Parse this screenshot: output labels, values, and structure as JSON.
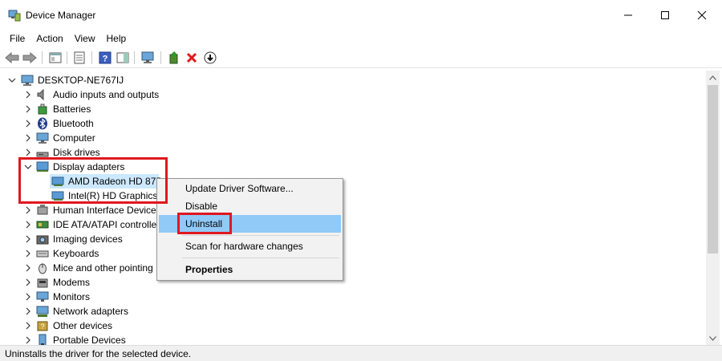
{
  "window": {
    "title": "Device Manager",
    "accent_border": "#4a90d9"
  },
  "menu": {
    "items": [
      "File",
      "Action",
      "View",
      "Help"
    ]
  },
  "toolbar": {
    "buttons": [
      "back-arrow-icon",
      "forward-arrow-icon",
      "show-hide-tree-icon",
      "properties-icon",
      "help-icon",
      "action-pane-icon",
      "scan-hardware-icon",
      "update-driver-icon",
      "uninstall-x-icon",
      "disable-down-arrow-icon"
    ],
    "uninstall_color": "#e0181e"
  },
  "tree": {
    "root": "DESKTOP-NE767IJ",
    "categories": [
      {
        "label": "Audio inputs and outputs",
        "icon": "speaker-icon"
      },
      {
        "label": "Batteries",
        "icon": "battery-icon"
      },
      {
        "label": "Bluetooth",
        "icon": "bluetooth-icon"
      },
      {
        "label": "Computer",
        "icon": "computer-icon"
      },
      {
        "label": "Disk drives",
        "icon": "disk-drive-icon"
      },
      {
        "label": "Display adapters",
        "icon": "display-adapter-icon",
        "expanded": true,
        "children": [
          "AMD Radeon HD 875",
          "Intel(R) HD Graphics"
        ]
      },
      {
        "label": "Human Interface Devices",
        "icon": "hid-icon"
      },
      {
        "label": "IDE ATA/ATAPI controller",
        "icon": "ide-controller-icon"
      },
      {
        "label": "Imaging devices",
        "icon": "camera-icon"
      },
      {
        "label": "Keyboards",
        "icon": "keyboard-icon"
      },
      {
        "label": "Mice and other pointing",
        "icon": "mouse-icon"
      },
      {
        "label": "Modems",
        "icon": "modem-icon"
      },
      {
        "label": "Monitors",
        "icon": "monitor-icon"
      },
      {
        "label": "Network adapters",
        "icon": "network-adapter-icon"
      },
      {
        "label": "Other devices",
        "icon": "other-devices-icon"
      },
      {
        "label": "Portable Devices",
        "icon": "portable-device-icon"
      }
    ]
  },
  "context_menu": {
    "items": [
      "Update Driver Software...",
      "Disable",
      "Uninstall",
      "Scan for hardware changes",
      "Properties"
    ],
    "highlighted": "Uninstall",
    "highlight_color": "#91c9f7"
  },
  "annotation": {
    "box_color": "#e0181e"
  },
  "status": {
    "text": "Uninstalls the driver for the selected device."
  }
}
